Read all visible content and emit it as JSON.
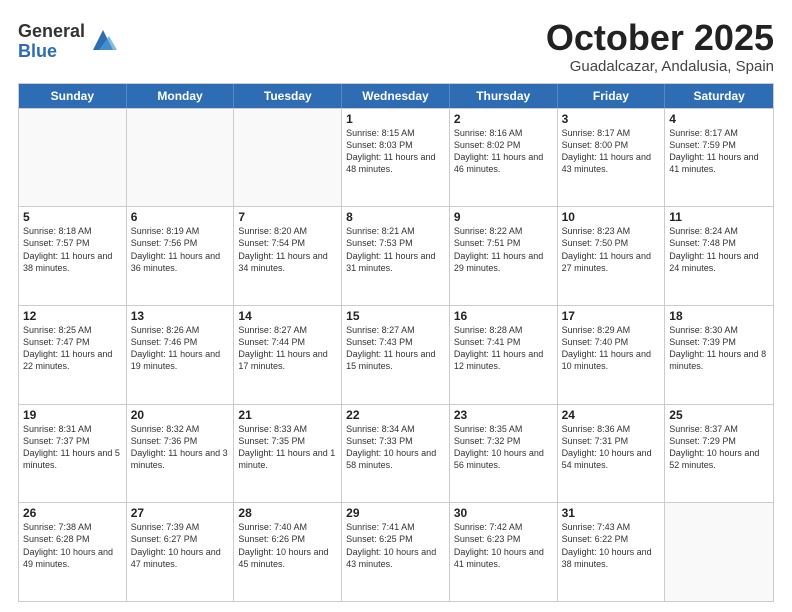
{
  "logo": {
    "general": "General",
    "blue": "Blue"
  },
  "header": {
    "title": "October 2025",
    "subtitle": "Guadalcazar, Andalusia, Spain"
  },
  "days": [
    "Sunday",
    "Monday",
    "Tuesday",
    "Wednesday",
    "Thursday",
    "Friday",
    "Saturday"
  ],
  "rows": [
    [
      {
        "day": "",
        "empty": true
      },
      {
        "day": "",
        "empty": true
      },
      {
        "day": "",
        "empty": true
      },
      {
        "day": "1",
        "sunrise": "Sunrise: 8:15 AM",
        "sunset": "Sunset: 8:03 PM",
        "daylight": "Daylight: 11 hours and 48 minutes."
      },
      {
        "day": "2",
        "sunrise": "Sunrise: 8:16 AM",
        "sunset": "Sunset: 8:02 PM",
        "daylight": "Daylight: 11 hours and 46 minutes."
      },
      {
        "day": "3",
        "sunrise": "Sunrise: 8:17 AM",
        "sunset": "Sunset: 8:00 PM",
        "daylight": "Daylight: 11 hours and 43 minutes."
      },
      {
        "day": "4",
        "sunrise": "Sunrise: 8:17 AM",
        "sunset": "Sunset: 7:59 PM",
        "daylight": "Daylight: 11 hours and 41 minutes."
      }
    ],
    [
      {
        "day": "5",
        "sunrise": "Sunrise: 8:18 AM",
        "sunset": "Sunset: 7:57 PM",
        "daylight": "Daylight: 11 hours and 38 minutes."
      },
      {
        "day": "6",
        "sunrise": "Sunrise: 8:19 AM",
        "sunset": "Sunset: 7:56 PM",
        "daylight": "Daylight: 11 hours and 36 minutes."
      },
      {
        "day": "7",
        "sunrise": "Sunrise: 8:20 AM",
        "sunset": "Sunset: 7:54 PM",
        "daylight": "Daylight: 11 hours and 34 minutes."
      },
      {
        "day": "8",
        "sunrise": "Sunrise: 8:21 AM",
        "sunset": "Sunset: 7:53 PM",
        "daylight": "Daylight: 11 hours and 31 minutes."
      },
      {
        "day": "9",
        "sunrise": "Sunrise: 8:22 AM",
        "sunset": "Sunset: 7:51 PM",
        "daylight": "Daylight: 11 hours and 29 minutes."
      },
      {
        "day": "10",
        "sunrise": "Sunrise: 8:23 AM",
        "sunset": "Sunset: 7:50 PM",
        "daylight": "Daylight: 11 hours and 27 minutes."
      },
      {
        "day": "11",
        "sunrise": "Sunrise: 8:24 AM",
        "sunset": "Sunset: 7:48 PM",
        "daylight": "Daylight: 11 hours and 24 minutes."
      }
    ],
    [
      {
        "day": "12",
        "sunrise": "Sunrise: 8:25 AM",
        "sunset": "Sunset: 7:47 PM",
        "daylight": "Daylight: 11 hours and 22 minutes."
      },
      {
        "day": "13",
        "sunrise": "Sunrise: 8:26 AM",
        "sunset": "Sunset: 7:46 PM",
        "daylight": "Daylight: 11 hours and 19 minutes."
      },
      {
        "day": "14",
        "sunrise": "Sunrise: 8:27 AM",
        "sunset": "Sunset: 7:44 PM",
        "daylight": "Daylight: 11 hours and 17 minutes."
      },
      {
        "day": "15",
        "sunrise": "Sunrise: 8:27 AM",
        "sunset": "Sunset: 7:43 PM",
        "daylight": "Daylight: 11 hours and 15 minutes."
      },
      {
        "day": "16",
        "sunrise": "Sunrise: 8:28 AM",
        "sunset": "Sunset: 7:41 PM",
        "daylight": "Daylight: 11 hours and 12 minutes."
      },
      {
        "day": "17",
        "sunrise": "Sunrise: 8:29 AM",
        "sunset": "Sunset: 7:40 PM",
        "daylight": "Daylight: 11 hours and 10 minutes."
      },
      {
        "day": "18",
        "sunrise": "Sunrise: 8:30 AM",
        "sunset": "Sunset: 7:39 PM",
        "daylight": "Daylight: 11 hours and 8 minutes."
      }
    ],
    [
      {
        "day": "19",
        "sunrise": "Sunrise: 8:31 AM",
        "sunset": "Sunset: 7:37 PM",
        "daylight": "Daylight: 11 hours and 5 minutes."
      },
      {
        "day": "20",
        "sunrise": "Sunrise: 8:32 AM",
        "sunset": "Sunset: 7:36 PM",
        "daylight": "Daylight: 11 hours and 3 minutes."
      },
      {
        "day": "21",
        "sunrise": "Sunrise: 8:33 AM",
        "sunset": "Sunset: 7:35 PM",
        "daylight": "Daylight: 11 hours and 1 minute."
      },
      {
        "day": "22",
        "sunrise": "Sunrise: 8:34 AM",
        "sunset": "Sunset: 7:33 PM",
        "daylight": "Daylight: 10 hours and 58 minutes."
      },
      {
        "day": "23",
        "sunrise": "Sunrise: 8:35 AM",
        "sunset": "Sunset: 7:32 PM",
        "daylight": "Daylight: 10 hours and 56 minutes."
      },
      {
        "day": "24",
        "sunrise": "Sunrise: 8:36 AM",
        "sunset": "Sunset: 7:31 PM",
        "daylight": "Daylight: 10 hours and 54 minutes."
      },
      {
        "day": "25",
        "sunrise": "Sunrise: 8:37 AM",
        "sunset": "Sunset: 7:29 PM",
        "daylight": "Daylight: 10 hours and 52 minutes."
      }
    ],
    [
      {
        "day": "26",
        "sunrise": "Sunrise: 7:38 AM",
        "sunset": "Sunset: 6:28 PM",
        "daylight": "Daylight: 10 hours and 49 minutes."
      },
      {
        "day": "27",
        "sunrise": "Sunrise: 7:39 AM",
        "sunset": "Sunset: 6:27 PM",
        "daylight": "Daylight: 10 hours and 47 minutes."
      },
      {
        "day": "28",
        "sunrise": "Sunrise: 7:40 AM",
        "sunset": "Sunset: 6:26 PM",
        "daylight": "Daylight: 10 hours and 45 minutes."
      },
      {
        "day": "29",
        "sunrise": "Sunrise: 7:41 AM",
        "sunset": "Sunset: 6:25 PM",
        "daylight": "Daylight: 10 hours and 43 minutes."
      },
      {
        "day": "30",
        "sunrise": "Sunrise: 7:42 AM",
        "sunset": "Sunset: 6:23 PM",
        "daylight": "Daylight: 10 hours and 41 minutes."
      },
      {
        "day": "31",
        "sunrise": "Sunrise: 7:43 AM",
        "sunset": "Sunset: 6:22 PM",
        "daylight": "Daylight: 10 hours and 38 minutes."
      },
      {
        "day": "",
        "empty": true
      }
    ]
  ]
}
